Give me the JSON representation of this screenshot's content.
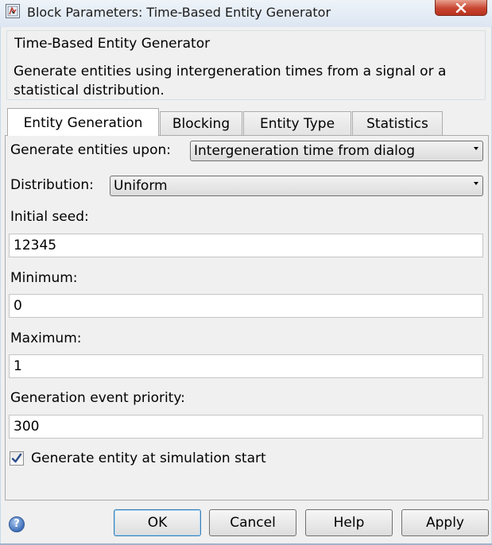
{
  "window": {
    "title": "Block Parameters: Time-Based Entity Generator",
    "app_icon": "simulink-block-icon",
    "close_icon": "close-x-icon"
  },
  "block": {
    "name": "Time-Based Entity Generator",
    "description": "Generate entities using intergeneration times from a signal or a statistical distribution."
  },
  "tabs": [
    {
      "label": "Entity Generation",
      "active": true
    },
    {
      "label": "Blocking",
      "active": false
    },
    {
      "label": "Entity Type",
      "active": false
    },
    {
      "label": "Statistics",
      "active": false
    }
  ],
  "form": {
    "generate_upon": {
      "label": "Generate entities upon:",
      "value": "Intergeneration time from dialog"
    },
    "distribution": {
      "label": "Distribution:",
      "value": "Uniform"
    },
    "initial_seed": {
      "label": "Initial seed:",
      "value": "12345"
    },
    "minimum": {
      "label": "Minimum:",
      "value": "0"
    },
    "maximum": {
      "label": "Maximum:",
      "value": "1"
    },
    "priority": {
      "label": "Generation event priority:",
      "value": "300"
    },
    "start_checkbox": {
      "label": "Generate entity at simulation start",
      "checked": true
    }
  },
  "buttons": {
    "ok": "OK",
    "cancel": "Cancel",
    "help": "Help",
    "apply": "Apply",
    "help_icon": "help-question-icon"
  },
  "colors": {
    "close_button": "#c84530",
    "default_button_border": "#3c7fb1",
    "checkmark": "#2a4e8a"
  }
}
